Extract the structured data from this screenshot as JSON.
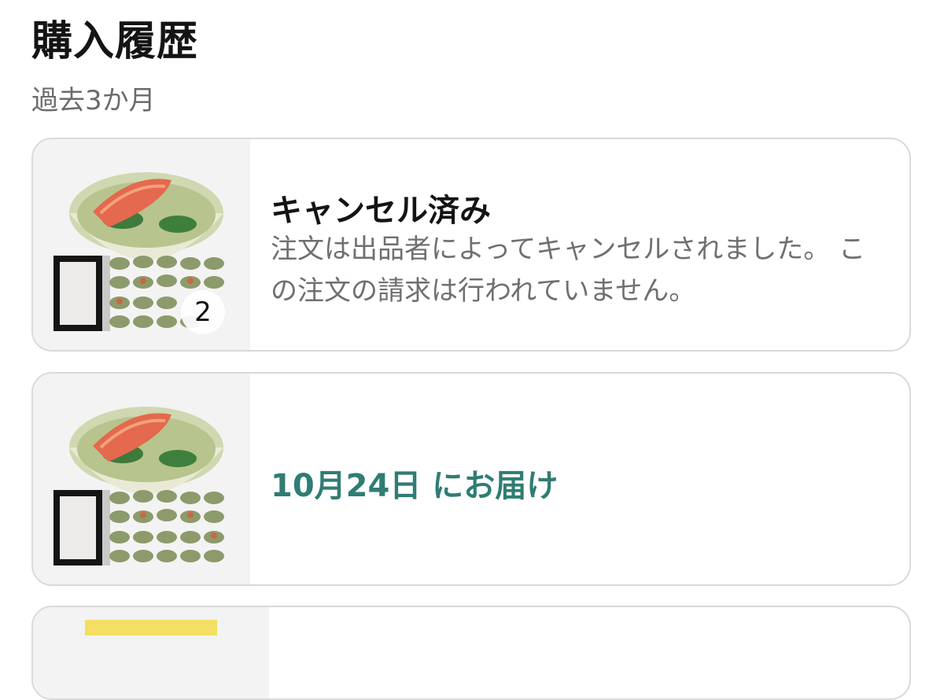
{
  "header": {
    "title": "購入履歴",
    "period": "過去3か月"
  },
  "orders": [
    {
      "thumbnail_icon": "seafood-rice-bowl-product-image",
      "quantity": "2",
      "status_title": "キャンセル済み",
      "status_desc": "注文は出品者によってキャンセルされました。 この注文の請求は行われていません。"
    },
    {
      "thumbnail_icon": "seafood-rice-bowl-product-image",
      "delivery": "10月24日 にお届け"
    }
  ],
  "colors": {
    "delivery_accent": "#2f7d73",
    "secondary_text": "#6f6f6f",
    "card_border": "#d9d9d9"
  }
}
